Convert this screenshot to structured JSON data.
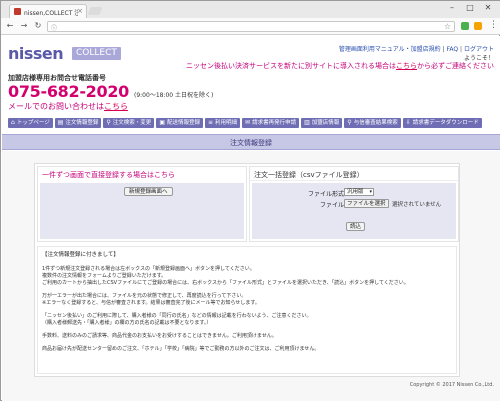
{
  "browser": {
    "tab_title": "nissen,COLLECT 注文登録",
    "tab_close": "×",
    "minimize": "–",
    "maximize": "□",
    "close": "✕",
    "address": "",
    "back": "←",
    "forward": "→",
    "reload": "↻"
  },
  "header": {
    "logo_text": "nissen",
    "logo_badge": "COLLECT",
    "links": [
      "管理画面利用マニュアル・加盟店規約",
      "FAQ",
      "ログアウト"
    ],
    "welcome": "ようこそ！",
    "notice_pre": "ニッセン後払い決済サービスを新たに別サイトに導入される場合は",
    "notice_link": "こちら",
    "notice_post": "から必ずご連絡ください",
    "contact_label": "加盟店様専用お問合せ電話番号",
    "phone": "075-682-2020",
    "hours": "(9:00～18:00 土日祝を除く)",
    "mail_pre": "メールでのお問い合わせは",
    "mail_link": "こちら"
  },
  "nav": [
    {
      "label": "トップページ",
      "icon": "home-icon"
    },
    {
      "label": "注文情報登録",
      "icon": "document-icon"
    },
    {
      "label": "注文検索・変更",
      "icon": "search-icon"
    },
    {
      "label": "配送情報登録",
      "icon": "truck-icon"
    },
    {
      "label": "利用明細",
      "icon": "list-icon"
    },
    {
      "label": "請求書再発行申請",
      "icon": "mail-icon"
    },
    {
      "label": "加盟店情報",
      "icon": "store-icon"
    },
    {
      "label": "与信審査結果検索",
      "icon": "search-icon"
    },
    {
      "label": "請求書データダウンロード",
      "icon": "download-icon"
    }
  ],
  "page_title": "注文情報登録",
  "direct_panel": {
    "heading": "一件ずつ画面で直接登録する場合はこちら",
    "button": "新規登録画面へ"
  },
  "bulk_panel": {
    "heading": "注文一括登録（csvファイル登録）",
    "format_label": "ファイル形式：",
    "format_value": "汎用版",
    "file_label": "ファイル：",
    "file_button": "ファイルを選択",
    "file_none": "選択されていません",
    "read_button": "読込"
  },
  "info": {
    "title": "【注文情報登録に付きまして】",
    "lines": [
      "1件ずつ新規注文登録される場合は左ボックスの「新規登録画面へ」ボタンを押してください。",
      "複数件の注文情報をフォームよりご登録いただけます。",
      "ご利用のカートから抽出したCSVファイルにてご登録の場合には、右ボックスから「ファイル形式」とファイルを選択いただき、「読込」ボタンを押してください。",
      "",
      "万が一エラーが出た場合には、ファイルを元の状態で修正して、再度読込を行って下さい。",
      "※エラーなく登録すると、与信が審査されます。結果は審査完了後にメール等でお知らせします。",
      "",
      "「ニッセン後払い」のご利用に際して、購入者様の「同行の氏名」などの情報は記載を行わないよう、ご注意ください。",
      "（購入者様郵送先・「購入者様」の欄の方の氏名の記載は不要となります。）",
      "",
      "手数料、送料のみのご請求等、商品代金のお支払いをお受けすることはできません。ご利用頂けません。",
      "",
      "商品お届け先が配送センター留めのご注文、「ホテル」「学校」「病院」等でご勤務の方以外のご注文は、ご利用頂けません。"
    ]
  },
  "footer": {
    "copyright": "Copyright © 2017 Nissen Co.,Ltd."
  }
}
